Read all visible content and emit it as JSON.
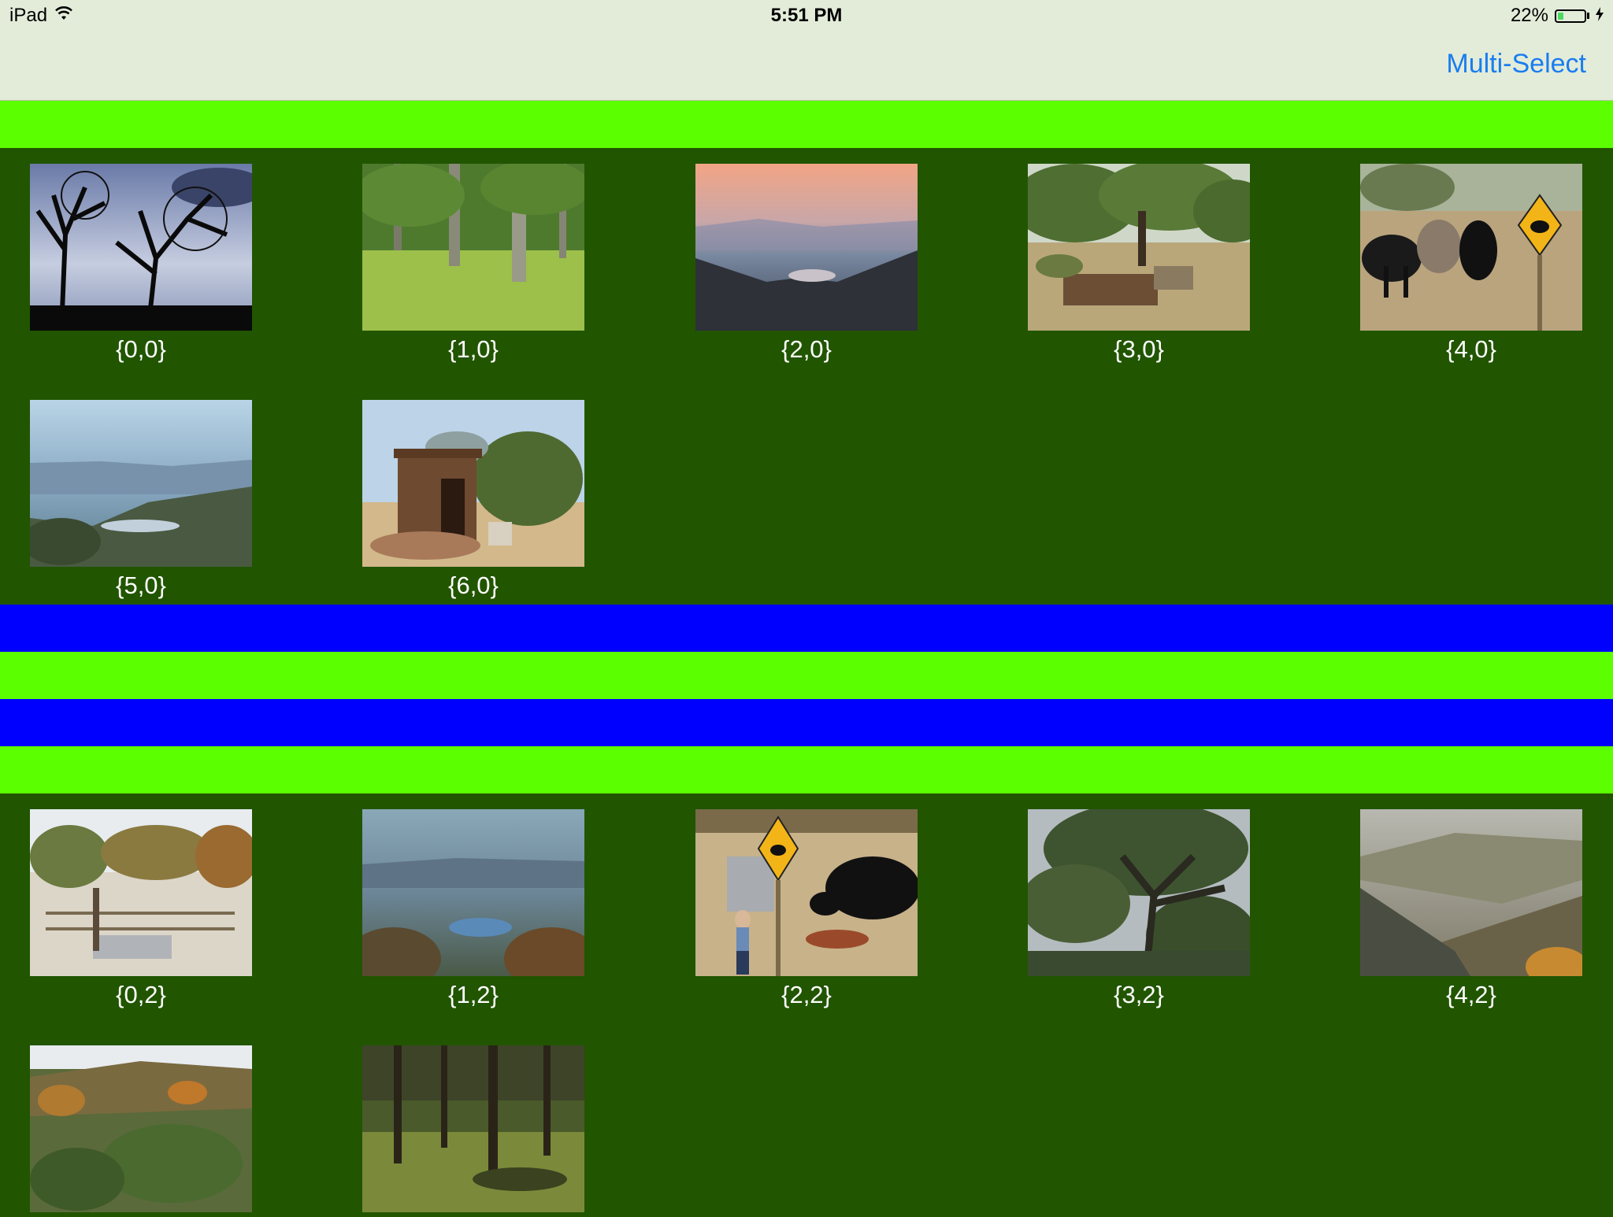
{
  "status_bar": {
    "device": "iPad",
    "time": "5:51 PM",
    "battery": "22%",
    "battery_level": 0.22,
    "icons": [
      "wifi-icon",
      "battery-icon",
      "charging-bolt-icon"
    ]
  },
  "nav": {
    "multi_select_label": "Multi-Select"
  },
  "colors": {
    "background": "#215500",
    "header_band": "#5cff00",
    "footer_band": "#0000ff",
    "nav_bar": "#e3ecd9",
    "accent": "#1a7df0"
  },
  "sections": [
    {
      "items": [
        {
          "label": "{0,0}",
          "scene": "silhouette trees against cloudy sky"
        },
        {
          "label": "{1,0}",
          "scene": "oak trees on grassy meadow"
        },
        {
          "label": "{2,0}",
          "scene": "sunset over hazy valley"
        },
        {
          "label": "{3,0}",
          "scene": "old farm equipment under oaks"
        },
        {
          "label": "{4,0}",
          "scene": "black cows by cattle sign"
        },
        {
          "label": "{5,0}",
          "scene": "valley view with lake"
        },
        {
          "label": "{6,0}",
          "scene": "wooden shed with firewood"
        }
      ]
    },
    {
      "items": []
    },
    {
      "items": [
        {
          "label": "{0,2}",
          "scene": "corral and water tank"
        },
        {
          "label": "{1,2}",
          "scene": "lake in distant valley"
        },
        {
          "label": "{2,2}",
          "scene": "child watching cow by cattle sign"
        },
        {
          "label": "{3,2}",
          "scene": "large oak tree"
        },
        {
          "label": "{4,2}",
          "scene": "rolling hills at dusk"
        },
        {
          "label": "",
          "scene": "autumn hillside brush"
        },
        {
          "label": "",
          "scene": "oak forest with shadows"
        }
      ]
    }
  ]
}
